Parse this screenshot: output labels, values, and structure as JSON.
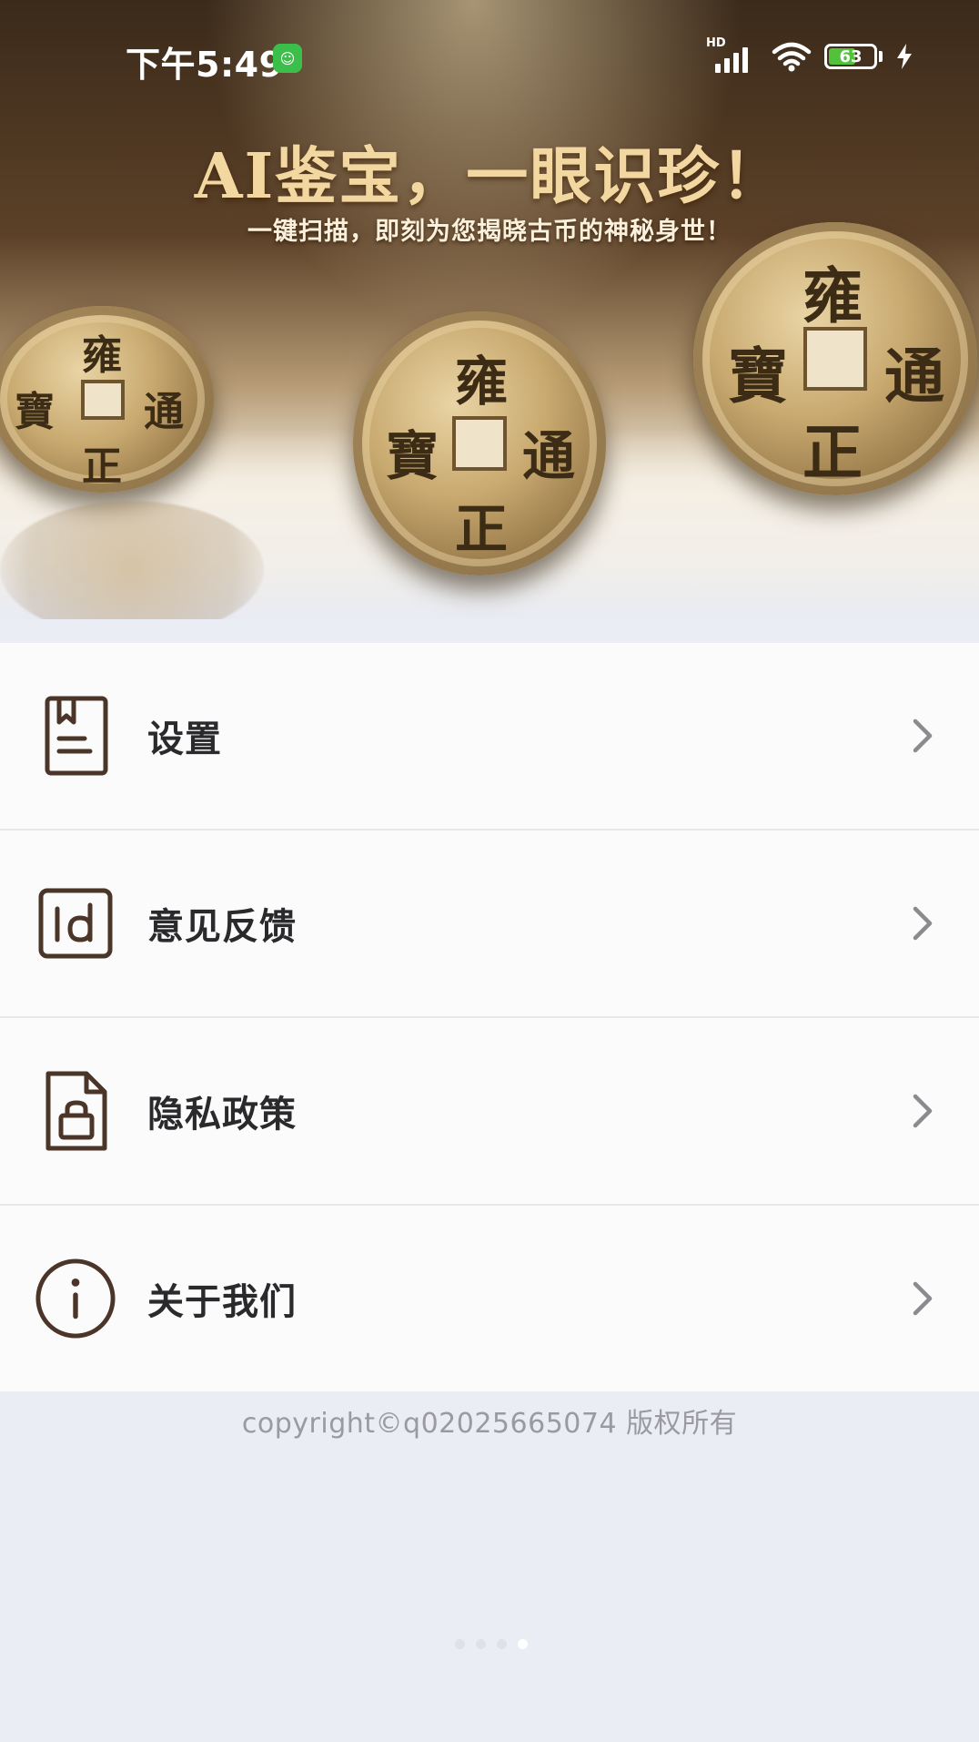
{
  "status_bar": {
    "time": "下午5:49",
    "network_label": "HD",
    "battery_level": "63"
  },
  "banner": {
    "headline": "AI鉴宝，一眼识珍！",
    "subline": "一键扫描，即刻为您揭晓古币的神秘身世！",
    "coins": [
      {
        "top": "雍",
        "left": "寶",
        "right": "通",
        "bottom": "正"
      },
      {
        "top": "雍",
        "left": "寶",
        "right": "通",
        "bottom": "正"
      },
      {
        "top": "雍",
        "left": "寶",
        "right": "通",
        "bottom": "正"
      }
    ]
  },
  "menu": {
    "items": [
      {
        "label": "设置",
        "icon": "document-bookmark-icon"
      },
      {
        "label": "意见反馈",
        "icon": "feedback-id-icon"
      },
      {
        "label": "隐私政策",
        "icon": "file-lock-icon"
      },
      {
        "label": "关于我们",
        "icon": "info-circle-icon"
      }
    ]
  },
  "footer": {
    "copyright": "copyright©q02025665074 版权所有"
  },
  "pagination": {
    "dot_count": 4,
    "active_index": 3
  },
  "colors": {
    "icon_stroke": "#4a3528",
    "text": "#2a2a2c",
    "muted_text": "#9a9aa0",
    "page_background": "#ebedf5",
    "list_background": "#fbfbfc"
  }
}
